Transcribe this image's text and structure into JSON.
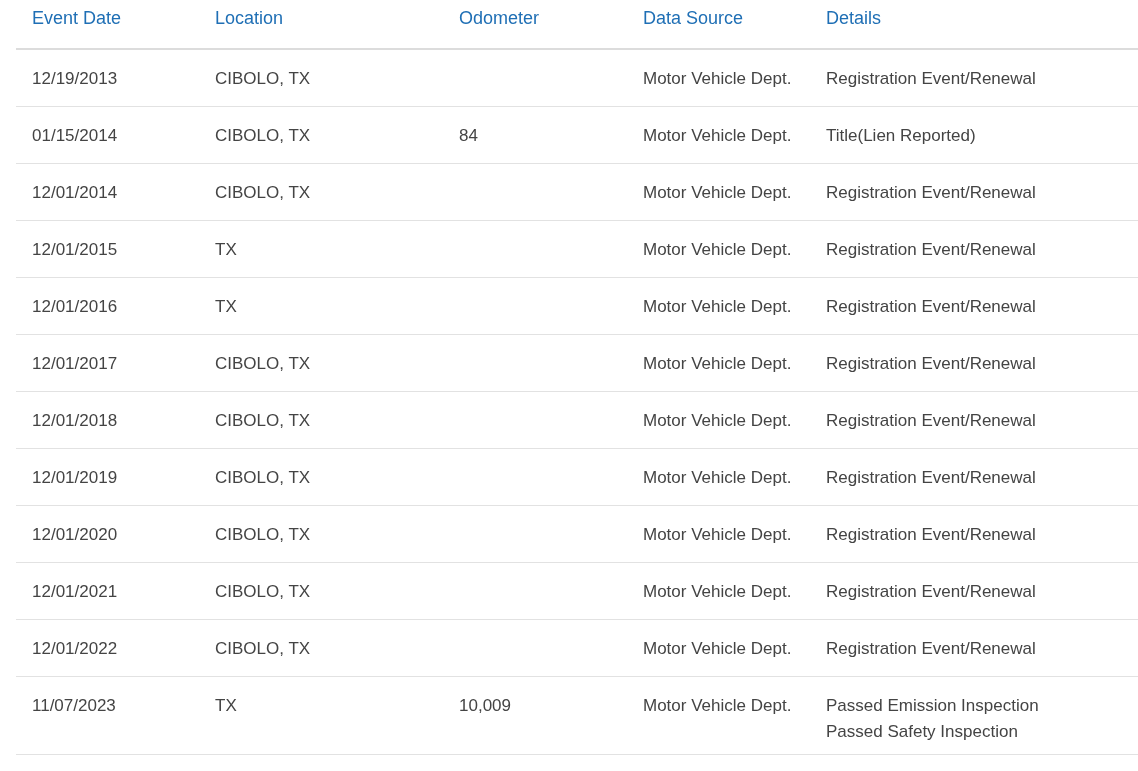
{
  "table": {
    "columns": [
      "Event Date",
      "Location",
      "Odometer",
      "Data Source",
      "Details"
    ],
    "rows": [
      {
        "date": "12/19/2013",
        "location": "CIBOLO, TX",
        "odometer": "",
        "source": "Motor Vehicle Dept.",
        "details": [
          "Registration Event/Renewal"
        ]
      },
      {
        "date": "01/15/2014",
        "location": "CIBOLO, TX",
        "odometer": "84",
        "source": "Motor Vehicle Dept.",
        "details": [
          "Title(Lien Reported)"
        ]
      },
      {
        "date": "12/01/2014",
        "location": "CIBOLO, TX",
        "odometer": "",
        "source": "Motor Vehicle Dept.",
        "details": [
          "Registration Event/Renewal"
        ]
      },
      {
        "date": "12/01/2015",
        "location": "TX",
        "odometer": "",
        "source": "Motor Vehicle Dept.",
        "details": [
          "Registration Event/Renewal"
        ]
      },
      {
        "date": "12/01/2016",
        "location": "TX",
        "odometer": "",
        "source": "Motor Vehicle Dept.",
        "details": [
          "Registration Event/Renewal"
        ]
      },
      {
        "date": "12/01/2017",
        "location": "CIBOLO, TX",
        "odometer": "",
        "source": "Motor Vehicle Dept.",
        "details": [
          "Registration Event/Renewal"
        ]
      },
      {
        "date": "12/01/2018",
        "location": "CIBOLO, TX",
        "odometer": "",
        "source": "Motor Vehicle Dept.",
        "details": [
          "Registration Event/Renewal"
        ]
      },
      {
        "date": "12/01/2019",
        "location": "CIBOLO, TX",
        "odometer": "",
        "source": "Motor Vehicle Dept.",
        "details": [
          "Registration Event/Renewal"
        ]
      },
      {
        "date": "12/01/2020",
        "location": "CIBOLO, TX",
        "odometer": "",
        "source": "Motor Vehicle Dept.",
        "details": [
          "Registration Event/Renewal"
        ]
      },
      {
        "date": "12/01/2021",
        "location": "CIBOLO, TX",
        "odometer": "",
        "source": "Motor Vehicle Dept.",
        "details": [
          "Registration Event/Renewal"
        ]
      },
      {
        "date": "12/01/2022",
        "location": "CIBOLO, TX",
        "odometer": "",
        "source": "Motor Vehicle Dept.",
        "details": [
          "Registration Event/Renewal"
        ]
      },
      {
        "date": "11/07/2023",
        "location": "TX",
        "odometer": "10,009",
        "source": "Motor Vehicle Dept.",
        "details": [
          "Passed Emission Inspection",
          "Passed Safety Inspection"
        ]
      }
    ]
  }
}
